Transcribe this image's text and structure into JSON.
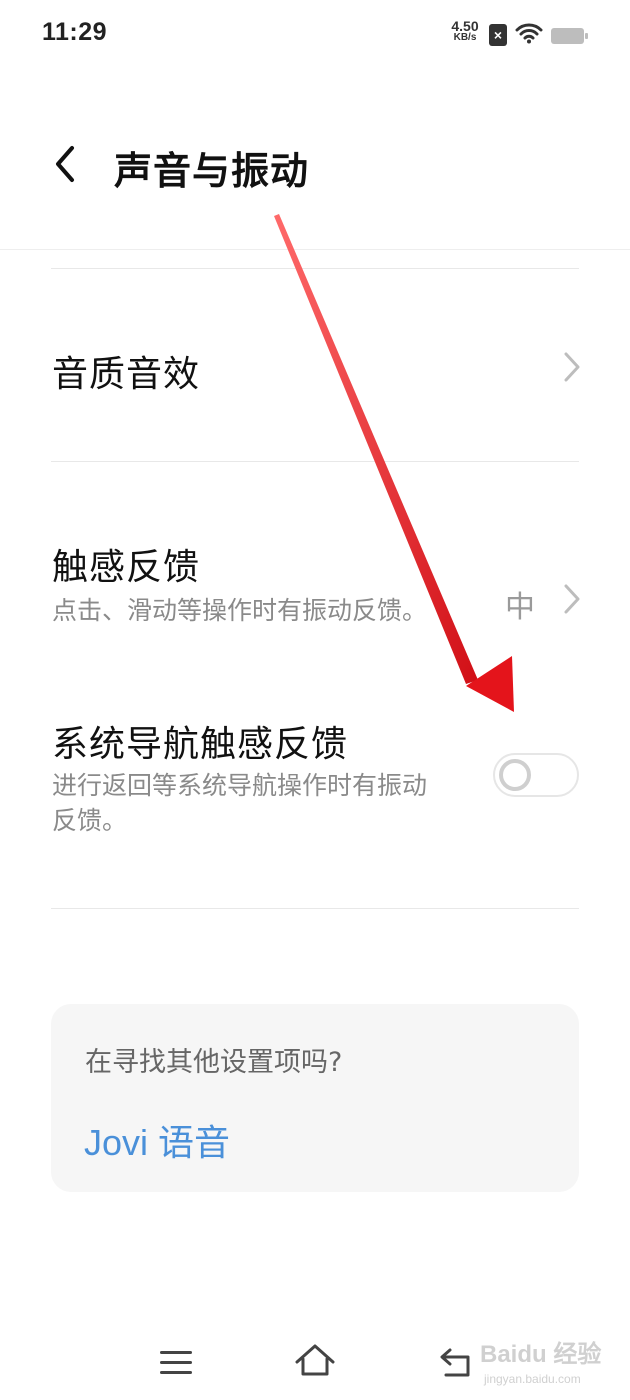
{
  "status_bar": {
    "time": "11:29",
    "net_speed_value": "4.50",
    "net_speed_unit": "KB/s",
    "sim_icon": "no-sim-icon",
    "wifi_icon": "wifi-icon",
    "battery_icon": "battery-icon"
  },
  "header": {
    "back_icon": "chevron-left-icon",
    "title": "声音与振动"
  },
  "settings": {
    "sound_quality": {
      "title": "音质音效"
    },
    "haptic_feedback": {
      "title": "触感反馈",
      "description": "点击、滑动等操作时有振动反馈。",
      "value": "中"
    },
    "nav_haptic_feedback": {
      "title": "系统导航触感反馈",
      "description": "进行返回等系统导航操作时有振动反馈。",
      "enabled": false
    }
  },
  "suggestion_card": {
    "question": "在寻找其他设置项吗?",
    "link": "Jovi 语音"
  },
  "nav_bar": {
    "menu_icon": "menu-icon",
    "home_icon": "home-icon",
    "back_icon": "back-icon"
  },
  "annotation": {
    "arrow_color": "#e4141b"
  },
  "watermark": {
    "brand": "Baidu 经验",
    "url": "jingyan.baidu.com"
  },
  "colors": {
    "link": "#4a90d9",
    "secondary_text": "#8a8a8a",
    "card_bg": "#f6f6f6"
  }
}
